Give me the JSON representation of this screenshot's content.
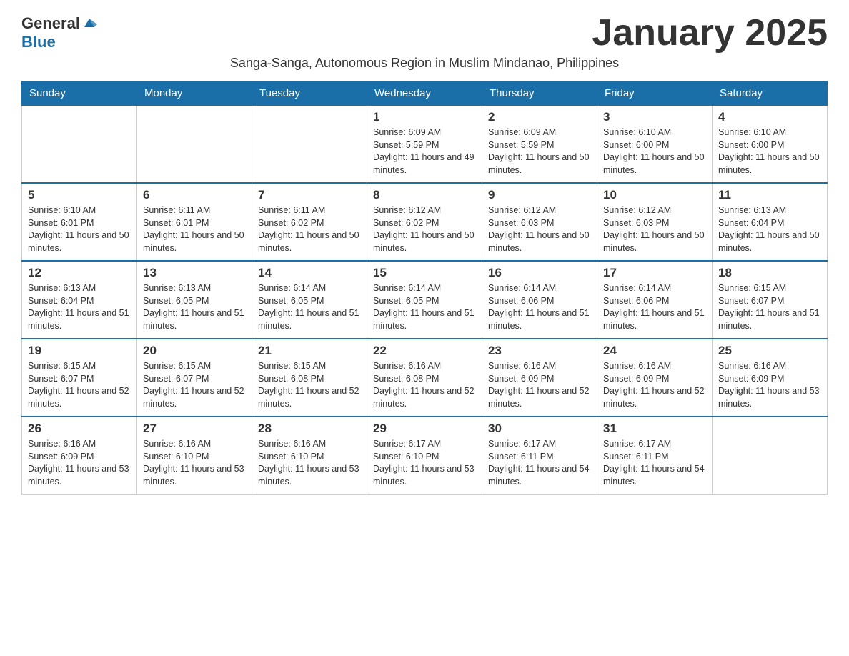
{
  "logo": {
    "general": "General",
    "blue": "Blue"
  },
  "title": "January 2025",
  "subtitle": "Sanga-Sanga, Autonomous Region in Muslim Mindanao, Philippines",
  "headers": [
    "Sunday",
    "Monday",
    "Tuesday",
    "Wednesday",
    "Thursday",
    "Friday",
    "Saturday"
  ],
  "weeks": [
    [
      {
        "day": "",
        "info": ""
      },
      {
        "day": "",
        "info": ""
      },
      {
        "day": "",
        "info": ""
      },
      {
        "day": "1",
        "info": "Sunrise: 6:09 AM\nSunset: 5:59 PM\nDaylight: 11 hours and 49 minutes."
      },
      {
        "day": "2",
        "info": "Sunrise: 6:09 AM\nSunset: 5:59 PM\nDaylight: 11 hours and 50 minutes."
      },
      {
        "day": "3",
        "info": "Sunrise: 6:10 AM\nSunset: 6:00 PM\nDaylight: 11 hours and 50 minutes."
      },
      {
        "day": "4",
        "info": "Sunrise: 6:10 AM\nSunset: 6:00 PM\nDaylight: 11 hours and 50 minutes."
      }
    ],
    [
      {
        "day": "5",
        "info": "Sunrise: 6:10 AM\nSunset: 6:01 PM\nDaylight: 11 hours and 50 minutes."
      },
      {
        "day": "6",
        "info": "Sunrise: 6:11 AM\nSunset: 6:01 PM\nDaylight: 11 hours and 50 minutes."
      },
      {
        "day": "7",
        "info": "Sunrise: 6:11 AM\nSunset: 6:02 PM\nDaylight: 11 hours and 50 minutes."
      },
      {
        "day": "8",
        "info": "Sunrise: 6:12 AM\nSunset: 6:02 PM\nDaylight: 11 hours and 50 minutes."
      },
      {
        "day": "9",
        "info": "Sunrise: 6:12 AM\nSunset: 6:03 PM\nDaylight: 11 hours and 50 minutes."
      },
      {
        "day": "10",
        "info": "Sunrise: 6:12 AM\nSunset: 6:03 PM\nDaylight: 11 hours and 50 minutes."
      },
      {
        "day": "11",
        "info": "Sunrise: 6:13 AM\nSunset: 6:04 PM\nDaylight: 11 hours and 50 minutes."
      }
    ],
    [
      {
        "day": "12",
        "info": "Sunrise: 6:13 AM\nSunset: 6:04 PM\nDaylight: 11 hours and 51 minutes."
      },
      {
        "day": "13",
        "info": "Sunrise: 6:13 AM\nSunset: 6:05 PM\nDaylight: 11 hours and 51 minutes."
      },
      {
        "day": "14",
        "info": "Sunrise: 6:14 AM\nSunset: 6:05 PM\nDaylight: 11 hours and 51 minutes."
      },
      {
        "day": "15",
        "info": "Sunrise: 6:14 AM\nSunset: 6:05 PM\nDaylight: 11 hours and 51 minutes."
      },
      {
        "day": "16",
        "info": "Sunrise: 6:14 AM\nSunset: 6:06 PM\nDaylight: 11 hours and 51 minutes."
      },
      {
        "day": "17",
        "info": "Sunrise: 6:14 AM\nSunset: 6:06 PM\nDaylight: 11 hours and 51 minutes."
      },
      {
        "day": "18",
        "info": "Sunrise: 6:15 AM\nSunset: 6:07 PM\nDaylight: 11 hours and 51 minutes."
      }
    ],
    [
      {
        "day": "19",
        "info": "Sunrise: 6:15 AM\nSunset: 6:07 PM\nDaylight: 11 hours and 52 minutes."
      },
      {
        "day": "20",
        "info": "Sunrise: 6:15 AM\nSunset: 6:07 PM\nDaylight: 11 hours and 52 minutes."
      },
      {
        "day": "21",
        "info": "Sunrise: 6:15 AM\nSunset: 6:08 PM\nDaylight: 11 hours and 52 minutes."
      },
      {
        "day": "22",
        "info": "Sunrise: 6:16 AM\nSunset: 6:08 PM\nDaylight: 11 hours and 52 minutes."
      },
      {
        "day": "23",
        "info": "Sunrise: 6:16 AM\nSunset: 6:09 PM\nDaylight: 11 hours and 52 minutes."
      },
      {
        "day": "24",
        "info": "Sunrise: 6:16 AM\nSunset: 6:09 PM\nDaylight: 11 hours and 52 minutes."
      },
      {
        "day": "25",
        "info": "Sunrise: 6:16 AM\nSunset: 6:09 PM\nDaylight: 11 hours and 53 minutes."
      }
    ],
    [
      {
        "day": "26",
        "info": "Sunrise: 6:16 AM\nSunset: 6:09 PM\nDaylight: 11 hours and 53 minutes."
      },
      {
        "day": "27",
        "info": "Sunrise: 6:16 AM\nSunset: 6:10 PM\nDaylight: 11 hours and 53 minutes."
      },
      {
        "day": "28",
        "info": "Sunrise: 6:16 AM\nSunset: 6:10 PM\nDaylight: 11 hours and 53 minutes."
      },
      {
        "day": "29",
        "info": "Sunrise: 6:17 AM\nSunset: 6:10 PM\nDaylight: 11 hours and 53 minutes."
      },
      {
        "day": "30",
        "info": "Sunrise: 6:17 AM\nSunset: 6:11 PM\nDaylight: 11 hours and 54 minutes."
      },
      {
        "day": "31",
        "info": "Sunrise: 6:17 AM\nSunset: 6:11 PM\nDaylight: 11 hours and 54 minutes."
      },
      {
        "day": "",
        "info": ""
      }
    ]
  ]
}
